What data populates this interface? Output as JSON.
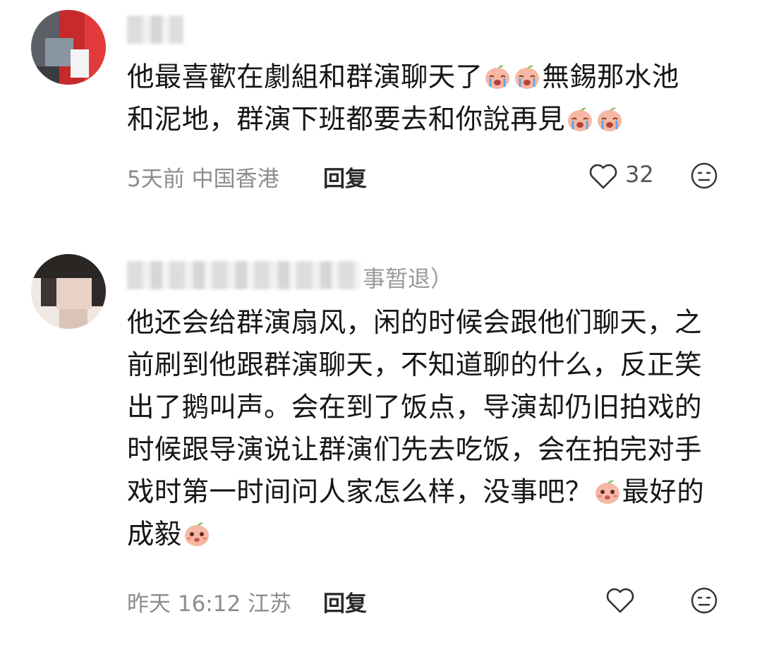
{
  "comments": [
    {
      "name_suffix": "",
      "lines": [
        {
          "text": "他最喜歡在劇組和群演聊天了",
          "emojis": 2,
          "tail": "無錫那水池"
        },
        {
          "text": "和泥地，群演下班都要去和你說再見",
          "emojis": 2,
          "tail": ""
        }
      ],
      "meta": "5天前 中国香港",
      "reply": "回复",
      "likes": "32",
      "emoji_icon": "crying-peach-emoji"
    },
    {
      "name_suffix": "‍事暂退）",
      "lines": [
        {
          "text": "他还会给群演扇风，闲的时候会跟他们聊天，之"
        },
        {
          "text": "前刷到他跟群演聊天，不知道聊的什么，反正笑"
        },
        {
          "text": "出了鹅叫声。会在到了饭点，导演却仍旧拍戏的"
        },
        {
          "text": "时候跟导演说让群演们先去吃饭，会在拍完对手"
        },
        {
          "text": "戏时第一时间问人家怎么样，没事吧？",
          "emojis": 1,
          "tail": "最好的"
        },
        {
          "text": "成毅",
          "emojis": 1,
          "tail": ""
        }
      ],
      "meta": "昨天 16:12 江苏",
      "reply": "回复",
      "likes": "",
      "emoji_icon": "peach-emoji"
    }
  ],
  "watermark": "",
  "colors": {
    "meta": "#8c8c8c",
    "text": "#161616",
    "emoji_skin": "#f6b8a4",
    "emoji_leaf": "#8cc36b"
  }
}
